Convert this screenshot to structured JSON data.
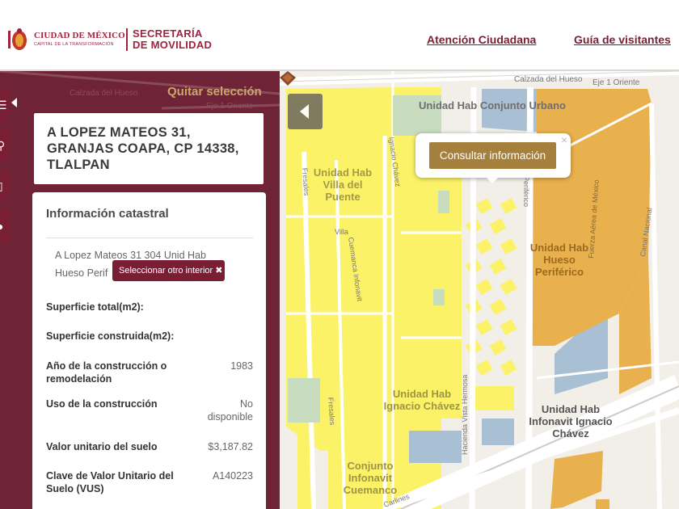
{
  "header": {
    "cdmx_line1": "CIUDAD DE MÉXICO",
    "cdmx_line2": "CAPITAL DE LA TRANSFORMACIÓN",
    "agency_line1": "SECRETARÍA",
    "agency_line2": "DE MOVILIDAD",
    "nav": [
      "Atención Ciudadana",
      "Guía de visitantes"
    ]
  },
  "sidebar": {
    "clear_selection": "Quitar selección",
    "address": [
      "A LOPEZ MATEOS 31,",
      "GRANJAS COAPA, CP 14338,",
      "TLALPAN"
    ],
    "info": {
      "title": "Información catastral",
      "interior_line1": "A Lopez Mateos 31 304 Unid Hab",
      "interior_line2": "Hueso Perif",
      "select_other_label": "Seleccionar otro interior ✖",
      "rows": [
        {
          "label": "Superficie total(m2):",
          "value": ""
        },
        {
          "label": "Superficie construida(m2):",
          "value": ""
        },
        {
          "label": "Año de la construcción o remodelación",
          "value": "1983"
        },
        {
          "label": "Uso de la construcción",
          "value": "No disponible"
        },
        {
          "label": "Valor unitario del suelo",
          "value": "$3,187.82"
        },
        {
          "label": "Clave de Valor Unitario del Suelo (VUS)",
          "value": "A140223"
        }
      ]
    },
    "background_road_labels": [
      "Calzada del Hueso",
      "Eje 1 Oriente"
    ]
  },
  "map": {
    "popup_button": "Consultar información",
    "popup_close": "×",
    "area_labels": [
      "Unidad Hab Conjunto Urbano",
      "Unidad Hab Villa del Puente",
      "Unidad Hab Hueso Periférico",
      "Unidad Hab Ignacio Chávez",
      "Unidad Hab Infonavit Ignacio Chávez",
      "Conjunto Infonavit Cuemanco"
    ],
    "street_labels": [
      "Calzada del Hueso",
      "Eje 1 Oriente",
      "Ignacio Chávez",
      "Fresales",
      "Villa",
      "Cuemanca Infonavit",
      "Fuerza Aérea de México",
      "Canal Nacional",
      "Hacienda Vista Hermosa",
      "Periférico",
      "Carlines"
    ],
    "colors": {
      "residential_yellow": "#fbf268",
      "orange_zone": "#e9b04e",
      "water_blue": "#a9bfd3",
      "park_green": "#c8dcc0",
      "brand_maroon": "#7a1e34",
      "popup_gold": "#a57f3c"
    }
  }
}
